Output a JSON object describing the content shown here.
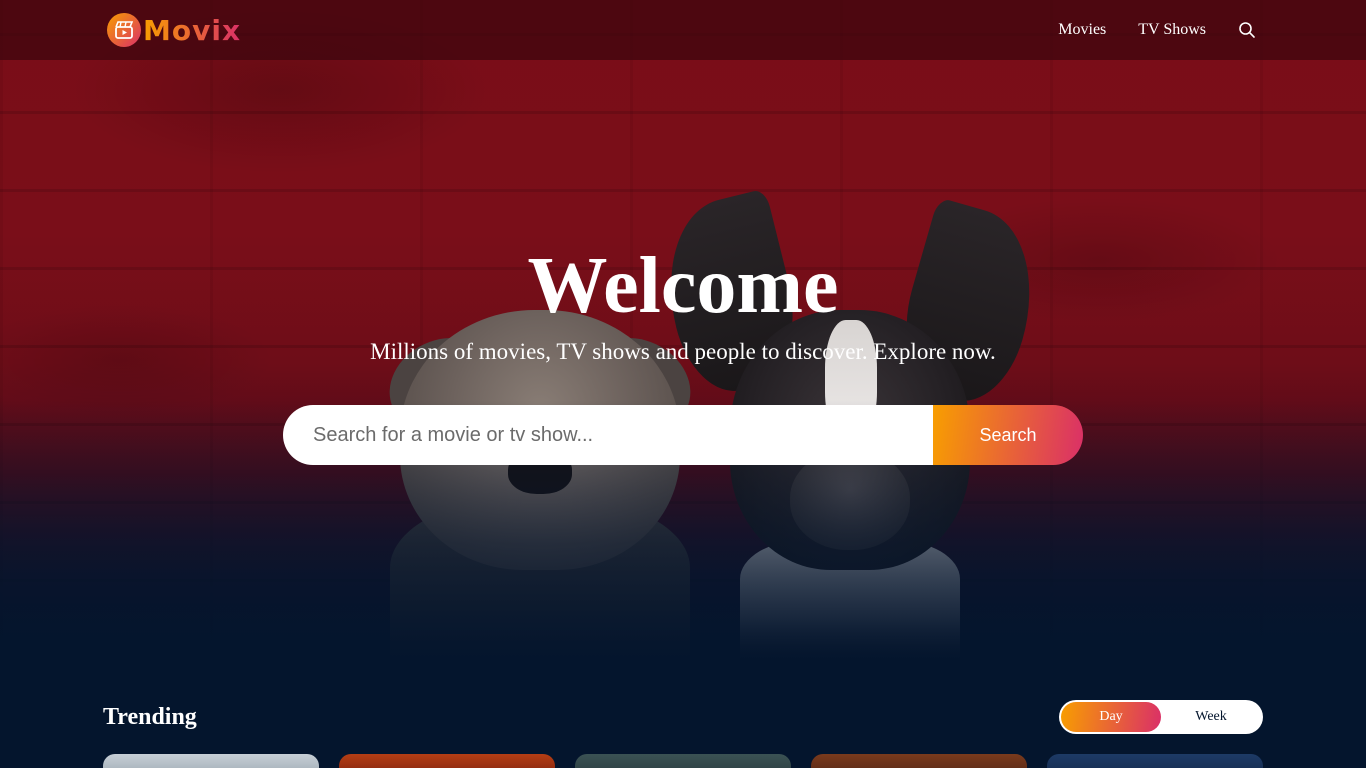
{
  "header": {
    "logo_text": "Movix",
    "nav": [
      {
        "label": "Movies"
      },
      {
        "label": "TV Shows"
      }
    ]
  },
  "hero": {
    "title": "Welcome",
    "subtitle": "Millions of movies, TV shows and people to discover. Explore now.",
    "search": {
      "placeholder": "Search for a movie or tv show...",
      "value": "",
      "button_label": "Search"
    }
  },
  "trending": {
    "title": "Trending",
    "tabs": [
      {
        "label": "Day",
        "active": true
      },
      {
        "label": "Week",
        "active": false
      }
    ]
  },
  "colors": {
    "accent_start": "#f89e00",
    "accent_end": "#da2f68",
    "background": "#04152d",
    "hero_red": "#7a0d17"
  },
  "icons": [
    "movie-clapper-icon",
    "search-icon"
  ]
}
